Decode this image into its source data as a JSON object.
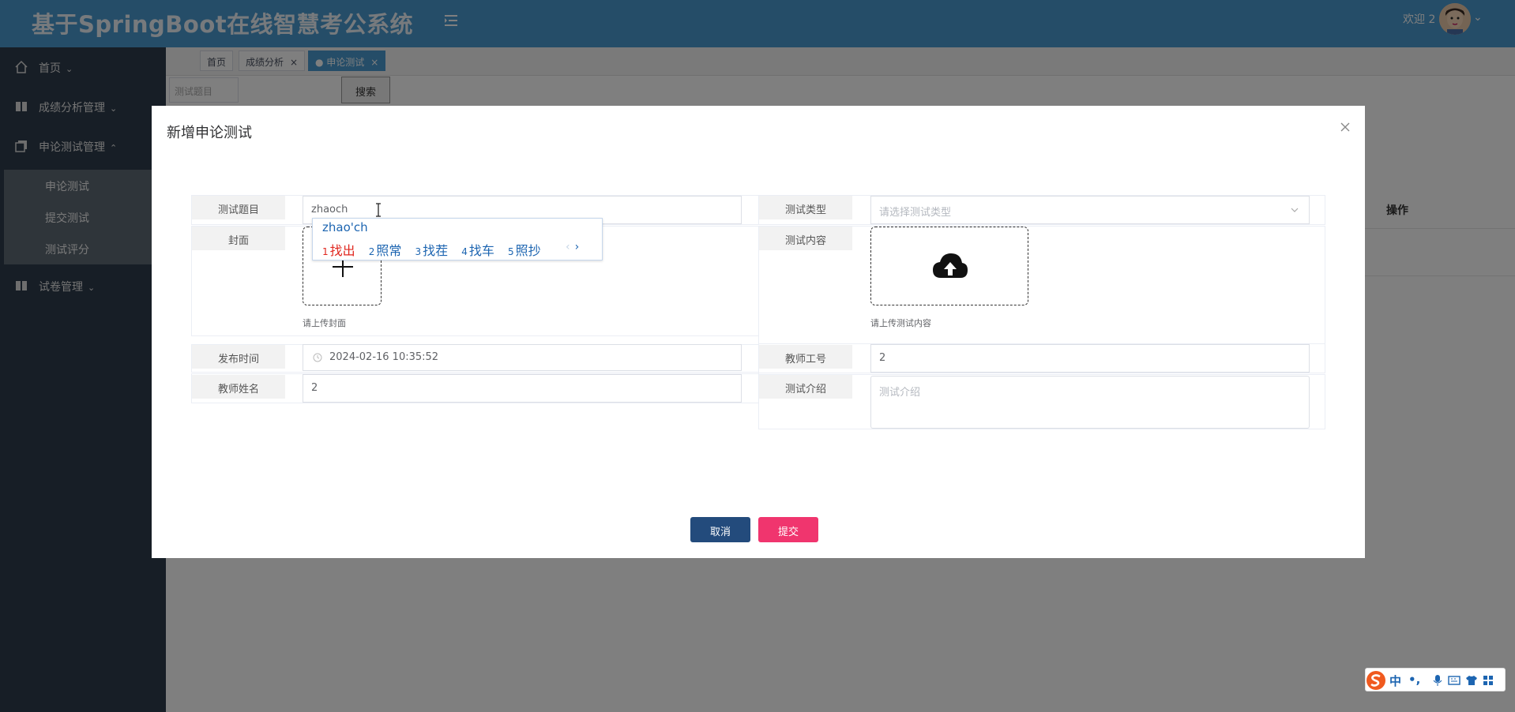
{
  "header": {
    "title": "基于SpringBoot在线智慧考公系统",
    "welcome": "欢迎 2"
  },
  "sidebar": {
    "items": [
      {
        "label": "首页",
        "icon": "home-icon"
      },
      {
        "label": "成绩分析管理",
        "icon": "grid-icon"
      },
      {
        "label": "申论测试管理",
        "icon": "copy-icon"
      },
      {
        "label": "试卷管理",
        "icon": "book-icon"
      }
    ],
    "submenu": [
      "申论测试",
      "提交测试",
      "测试评分"
    ]
  },
  "tabs": [
    {
      "label": "首页"
    },
    {
      "label": "成绩分析",
      "close": "×"
    },
    {
      "label": "● 申论测试",
      "close": "×"
    }
  ],
  "toolbar": {
    "search_placeholder": "测试题目",
    "search_button": "搜索"
  },
  "table": {
    "op_header": "操作"
  },
  "dialog": {
    "title": "新增申论测试",
    "form": {
      "title_label": "测试题目",
      "title_value": "zhaoch",
      "type_label": "测试类型",
      "type_placeholder": "请选择测试类型",
      "cover_label": "封面",
      "cover_hint": "请上传封面",
      "content_label": "测试内容",
      "content_hint": "请上传测试内容",
      "publish_label": "发布时间",
      "publish_value": "2024-02-16 10:35:52",
      "teacher_id_label": "教师工号",
      "teacher_id_value": "2",
      "teacher_name_label": "教师姓名",
      "teacher_name_value": "2",
      "intro_label": "测试介绍",
      "intro_placeholder": "测试介绍"
    },
    "buttons": {
      "cancel": "取消",
      "submit": "提交"
    }
  },
  "ime": {
    "composition": "zhao'ch",
    "candidates": [
      {
        "num": "1",
        "text": "找出"
      },
      {
        "num": "2",
        "text": "照常"
      },
      {
        "num": "3",
        "text": "找茬"
      },
      {
        "num": "4",
        "text": "找车"
      },
      {
        "num": "5",
        "text": "照抄"
      }
    ],
    "prev": "‹",
    "next": "›"
  },
  "ime_bar": {
    "lang": "中",
    "punct": "•,",
    "icons": [
      "mic-icon",
      "keyboard-icon",
      "shirt-icon",
      "grid-icon"
    ]
  },
  "colors": {
    "header": "#4a9ad0",
    "sidebar": "#2f3d4c",
    "cancel": "#234b7c",
    "submit": "#f0356e"
  }
}
